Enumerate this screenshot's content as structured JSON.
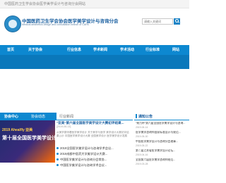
{
  "topbar": {
    "text": "中国医药卫生学会协会医学美学设计与咨询分会网站"
  },
  "header": {
    "title": "中国医药卫生学会协会医学美学设计与咨询分会",
    "subtitle": "Medical aesthetics design and consultation branch of CAPA",
    "search_placeholder": "请输入关键词"
  },
  "nav": {
    "items": [
      "首页",
      "关于协会",
      "行业信息",
      "学术新闻",
      "学术活动",
      "行业标准",
      "网站"
    ]
  },
  "tabs": {
    "active": "协会中心",
    "second": "协会动态",
    "third": "行业新闻"
  },
  "banner": {
    "line1": "2019 Ahealfly 亚美",
    "line2": "第十届全国医学美学设计大赛"
  },
  "news": {
    "headline": "\"亚美\"第六届全国医学美学设计大赛初评结果...",
    "date": "[2019-06-13]",
    "desc": "从美学原则看医学美学设计 关于美学与医学 美学设计大赛初评结果公示 中国医学美学设计大赛 全国美学设计 医学美学设计发展",
    "items": [
      "2019全国医学美学设计与咨询学术会议...",
      "2019成都中医药大学美学设计大赛...",
      "中国医学美学设计与咨询分会常务...",
      "中国医学美学设计与咨询学术会议..."
    ]
  },
  "notice": {
    "title": "通知公告",
    "items": [
      {
        "text": "\"致力杯\"第六届全国医学美学设计与咨询...",
        "date": "2019-06-14"
      },
      {
        "text": "医学美学咨询师国家标准设计与规范...",
        "date": "2019-05-30"
      },
      {
        "text": "中国医学美学设计与咨询分会理事...",
        "date": "2019-05-22"
      },
      {
        "text": "第二届江苏省医学美学设计论坛...",
        "date": "2019-04-16"
      },
      {
        "text": "全国第六届医学美学咨询师规范...",
        "date": "2019-03-28"
      }
    ]
  },
  "colors": {
    "brand": "#0d88d0",
    "dark": "#0a78bb"
  }
}
